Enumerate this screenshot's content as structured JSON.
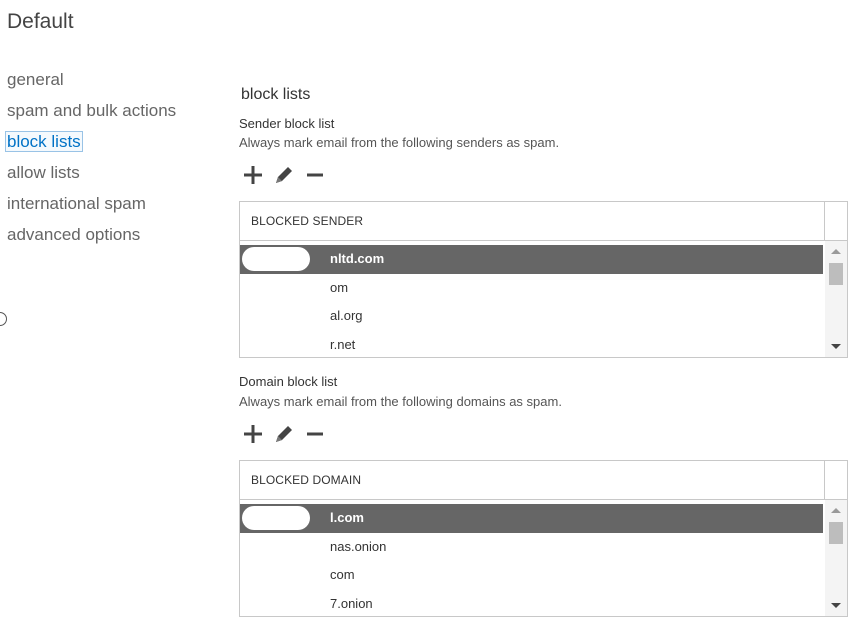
{
  "page": {
    "title": "Default"
  },
  "nav": {
    "items": [
      {
        "label": "general",
        "selected": false
      },
      {
        "label": "spam and bulk actions",
        "selected": false
      },
      {
        "label": "block lists",
        "selected": true
      },
      {
        "label": "allow lists",
        "selected": false
      },
      {
        "label": "international spam",
        "selected": false
      },
      {
        "label": "advanced options",
        "selected": false
      }
    ]
  },
  "section": {
    "title": "block lists"
  },
  "sender": {
    "label": "Sender block list",
    "description": "Always mark email from the following senders as spam.",
    "column_header": "BLOCKED SENDER",
    "rows": [
      "nltd.com",
      "om",
      "al.org",
      "r.net"
    ],
    "selected_index": 0,
    "scroll_position": 0
  },
  "domain": {
    "label": "Domain block list",
    "description": "Always mark email from the following domains as spam.",
    "column_header": "BLOCKED DOMAIN",
    "rows": [
      "l.com",
      "nas.onion",
      "com",
      "7.onion"
    ],
    "selected_index": 0,
    "scroll_position": 0
  },
  "toolbar": {
    "add_icon": "plus-icon",
    "edit_icon": "pencil-icon",
    "remove_icon": "minus-icon"
  },
  "colors": {
    "selected_nav": "#0072c6",
    "selected_row": "#666666"
  }
}
